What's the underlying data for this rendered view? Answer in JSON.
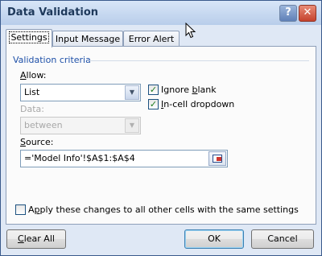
{
  "window": {
    "title": "Data Validation"
  },
  "titlebar": {
    "help_glyph": "?",
    "close_glyph": "✕"
  },
  "tabs": [
    {
      "label": "Settings",
      "active": true
    },
    {
      "label": "Input Message",
      "active": false
    },
    {
      "label": "Error Alert",
      "active": false
    }
  ],
  "settings": {
    "group_title": "Validation criteria",
    "allow": {
      "label_pre": "",
      "label_u": "A",
      "label_post": "llow:",
      "value": "List"
    },
    "data": {
      "label": "Data:",
      "value": "between",
      "disabled": true
    },
    "ignore_blank": {
      "label_pre": "Ignore ",
      "label_u": "b",
      "label_post": "lank",
      "checked": true
    },
    "incell_dropdown": {
      "label_pre": "",
      "label_u": "I",
      "label_post": "n-cell dropdown",
      "checked": true
    },
    "source": {
      "label_pre": "",
      "label_u": "S",
      "label_post": "ource:",
      "value": "='Model Info'!$A$1:$A$4"
    },
    "apply_all": {
      "label_pre": "A",
      "label_u": "p",
      "label_post": "ply these changes to all other cells with the same settings",
      "checked": false
    }
  },
  "buttons": {
    "clear_all": {
      "label_u": "C",
      "label_post": "lear All"
    },
    "ok": "OK",
    "cancel": "Cancel"
  },
  "colors": {
    "accent": "#1e50a8",
    "title_text": "#1e395b",
    "close": "#c5422d"
  }
}
